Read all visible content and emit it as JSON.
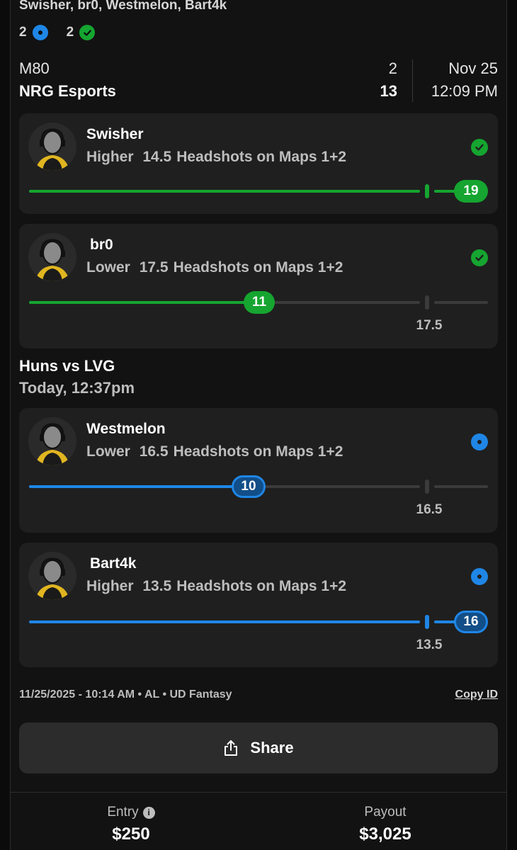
{
  "header": {
    "players": "Swisher, br0, Westmelon, Bart4k",
    "pending_count": "2",
    "won_count": "2"
  },
  "match1": {
    "team_a": "M80",
    "team_b": "NRG Esports",
    "score_a": "2",
    "score_b": "13",
    "date": "Nov 25",
    "time": "12:09 PM"
  },
  "match2": {
    "title": "Huns vs LVG",
    "subtitle": "Today, 12:37pm"
  },
  "picks": [
    {
      "name": "Swisher",
      "direction": "Higher",
      "line": "14.5",
      "stat": "Headshots on Maps 1+2",
      "result": "19",
      "status": "won",
      "line_label": ""
    },
    {
      "name": "br0",
      "direction": "Lower",
      "line": "17.5",
      "stat": "Headshots on Maps 1+2",
      "result": "11",
      "status": "won",
      "line_label": "17.5"
    },
    {
      "name": "Westmelon",
      "direction": "Lower",
      "line": "16.5",
      "stat": "Headshots on Maps 1+2",
      "result": "10",
      "status": "pending",
      "line_label": "16.5"
    },
    {
      "name": "Bart4k",
      "direction": "Higher",
      "line": "13.5",
      "stat": "Headshots on Maps 1+2",
      "result": "16",
      "status": "pending",
      "line_label": "13.5"
    }
  ],
  "meta": {
    "entry_info": "11/25/2025 - 10:14 AM • AL • UD Fantasy",
    "copy_id": "Copy ID",
    "share": "Share"
  },
  "footer": {
    "entry_label": "Entry",
    "entry_value": "$250",
    "payout_label": "Payout",
    "payout_value": "$3,025"
  },
  "colors": {
    "won": "#15a530",
    "pending": "#1f86e6"
  }
}
